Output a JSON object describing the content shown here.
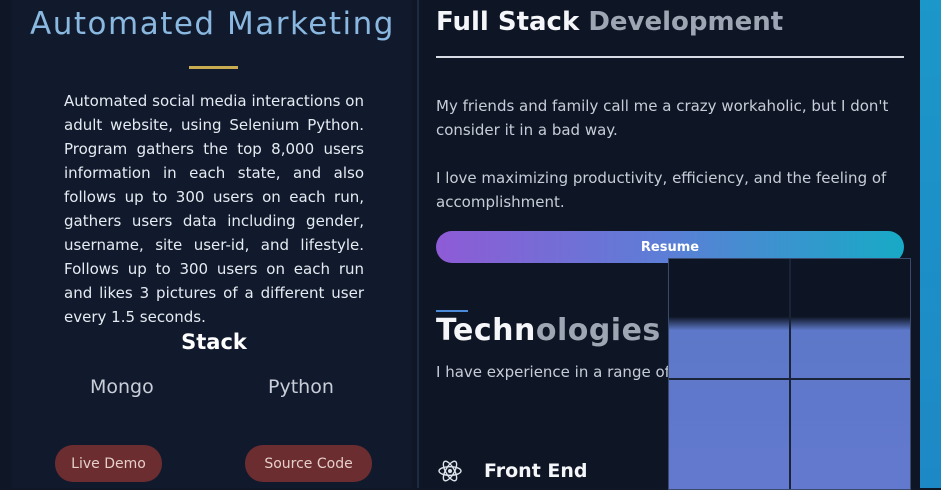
{
  "project": {
    "title": "Automated Marketing",
    "description": "Automated social media interactions on adult website, using Selenium Python. Program gathers the top 8,000 users information in each state, and also follows up to 300 users on each run, gathers users data including gender, username, site user-id, and lifestyle. Follows up to 300 users on each run and likes 3 pictures of a different user every 1.5 seconds.",
    "stack_heading": "Stack",
    "stack": [
      "Mongo",
      "Python"
    ],
    "live_demo_label": "Live Demo",
    "source_code_label": "Source Code"
  },
  "about": {
    "title_bright": "Full Stack ",
    "title_dim": "Development",
    "paragraph_1": "My friends and family call me a crazy workaholic, but I don't consider it in a bad way.",
    "paragraph_2": "I love maximizing productivity, efficiency, and the feeling of accomplishment.",
    "resume_label": "Resume"
  },
  "technologies": {
    "title_bright": "Techn",
    "title_dim": "ologies",
    "description": "I have experience in a range of frontend and backend / server-side development.",
    "frontend_label": "Front End"
  },
  "colors": {
    "accent_gold": "#c9ab52",
    "button_maroon": "#6b2d30",
    "resume_gradient_start": "#8e5bd6",
    "resume_gradient_end": "#17aac6",
    "title_blue": "#8ab8e0"
  },
  "icons": {
    "frontend": "react-icon"
  }
}
